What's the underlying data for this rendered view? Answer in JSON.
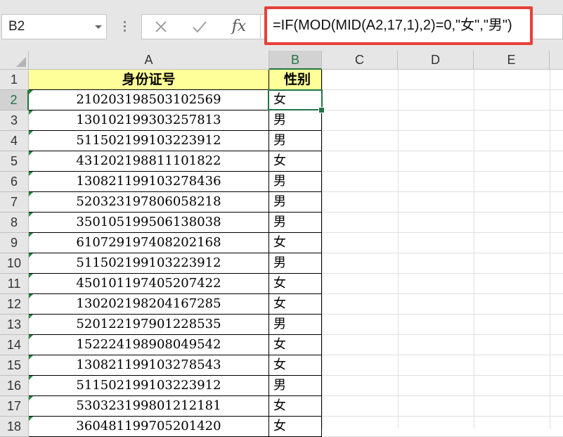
{
  "name_box": {
    "value": "B2"
  },
  "formula_bar": {
    "cancel_icon": "close-icon",
    "enter_icon": "check-icon",
    "fx_label": "fx",
    "formula": "=IF(MOD(MID(A2,17,1),2)=0,\"女\",\"男\")"
  },
  "columns": [
    "A",
    "B",
    "C",
    "D",
    "E"
  ],
  "selected_column": "B",
  "selected_row": "2",
  "rows": [
    {
      "num": "1",
      "a": "身份证号",
      "b": "性别"
    },
    {
      "num": "2",
      "a": "210203198503102569",
      "b": "女"
    },
    {
      "num": "3",
      "a": "130102199303257813",
      "b": "男"
    },
    {
      "num": "4",
      "a": "511502199103223912",
      "b": "男"
    },
    {
      "num": "5",
      "a": "431202198811101822",
      "b": "女"
    },
    {
      "num": "6",
      "a": "130821199103278436",
      "b": "男"
    },
    {
      "num": "7",
      "a": "520323197806058218",
      "b": "男"
    },
    {
      "num": "8",
      "a": "350105199506138038",
      "b": "男"
    },
    {
      "num": "9",
      "a": "610729197408202168",
      "b": "女"
    },
    {
      "num": "10",
      "a": "511502199103223912",
      "b": "男"
    },
    {
      "num": "11",
      "a": "450101197405207422",
      "b": "女"
    },
    {
      "num": "12",
      "a": "130202198204167285",
      "b": "女"
    },
    {
      "num": "13",
      "a": "520122197901228535",
      "b": "男"
    },
    {
      "num": "14",
      "a": "152224198908049542",
      "b": "女"
    },
    {
      "num": "15",
      "a": "130821199103278543",
      "b": "女"
    },
    {
      "num": "16",
      "a": "511502199103223912",
      "b": "男"
    },
    {
      "num": "17",
      "a": "530323199801212181",
      "b": "女"
    },
    {
      "num": "18",
      "a": "360481199705201420",
      "b": "女"
    }
  ],
  "colors": {
    "header_fill": "#ffff99",
    "selection": "#217346",
    "formula_highlight": "#e8403a"
  }
}
